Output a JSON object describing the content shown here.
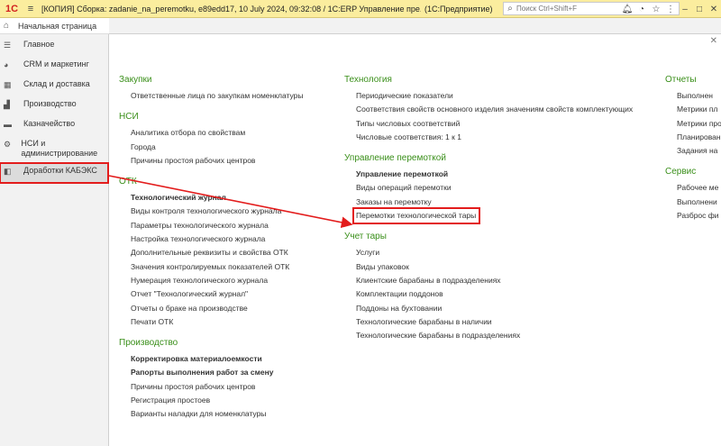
{
  "titlebar": {
    "logo": "1С",
    "title": "[КОПИЯ] Сборка: zadanie_na_peremotku, e89edd17, 10 July 2024, 09:32:08 / 1С:ERP Управление пре...",
    "mode": "(1С:Предприятие)",
    "search_placeholder": "Поиск Ctrl+Shift+F"
  },
  "home_tab": {
    "label": "Начальная страница"
  },
  "sidebar": {
    "items": [
      {
        "label": "Главное",
        "icon": "menu-icon"
      },
      {
        "label": "CRM и маркетинг",
        "icon": "pie-chart-icon"
      },
      {
        "label": "Склад и доставка",
        "icon": "warehouse-icon"
      },
      {
        "label": "Производство",
        "icon": "factory-icon"
      },
      {
        "label": "Казначейство",
        "icon": "money-icon"
      },
      {
        "label": "НСИ и администрирование",
        "icon": "gear-icon"
      },
      {
        "label": "Доработки КАБЭКС",
        "icon": "module-icon"
      }
    ]
  },
  "columns": {
    "left": [
      {
        "title": "Закупки",
        "items": [
          {
            "label": "Ответственные лица по закупкам номенклатуры",
            "bold": false
          }
        ]
      },
      {
        "title": "НСИ",
        "items": [
          {
            "label": "Аналитика отбора по свойствам",
            "bold": false
          },
          {
            "label": "Города",
            "bold": false
          },
          {
            "label": "Причины простоя рабочих центров",
            "bold": false
          }
        ]
      },
      {
        "title": "ОТК",
        "items": [
          {
            "label": "Технологический журнал",
            "bold": true
          },
          {
            "label": "Виды контроля технологического журнала",
            "bold": false
          },
          {
            "label": "Параметры технологического журнала",
            "bold": false
          },
          {
            "label": "Настройка технологического журнала",
            "bold": false
          },
          {
            "label": "Дополнительные реквизиты и свойства ОТК",
            "bold": false
          },
          {
            "label": "Значения контролируемых показателей ОТК",
            "bold": false
          },
          {
            "label": "Нумерация технологического журнала",
            "bold": false
          },
          {
            "label": "Отчет \"Технологический журнал\"",
            "bold": false
          },
          {
            "label": "Отчеты о браке на производстве",
            "bold": false
          },
          {
            "label": "Печати ОТК",
            "bold": false
          }
        ]
      },
      {
        "title": "Производство",
        "items": [
          {
            "label": "Корректировка материалоемкости",
            "bold": true
          },
          {
            "label": "Рапорты выполнения работ за смену",
            "bold": true
          },
          {
            "label": "Причины простоя рабочих центров",
            "bold": false
          },
          {
            "label": "Регистрация простоев",
            "bold": false
          },
          {
            "label": "Варианты наладки для номенклатуры",
            "bold": false
          }
        ]
      }
    ],
    "middle": [
      {
        "title": "Технология",
        "items": [
          {
            "label": "Периодические показатели",
            "bold": false
          },
          {
            "label": "Соответствия свойств основного изделия значениям свойств комплектующих",
            "bold": false
          },
          {
            "label": "Типы числовых соответствий",
            "bold": false
          },
          {
            "label": "Числовые соответствия: 1 к 1",
            "bold": false
          }
        ]
      },
      {
        "title": "Управление перемоткой",
        "items": [
          {
            "label": "Управление перемоткой",
            "bold": true
          },
          {
            "label": "Виды операций перемотки",
            "bold": false
          },
          {
            "label": "Заказы на перемотку",
            "bold": false
          },
          {
            "label": "Перемотки технологической тары",
            "bold": false,
            "highlight": true
          }
        ]
      },
      {
        "title": "Учет тары",
        "items": [
          {
            "label": "Услуги",
            "bold": false
          },
          {
            "label": "Виды упаковок",
            "bold": false
          },
          {
            "label": "Клиентские барабаны в подразделениях",
            "bold": false
          },
          {
            "label": "Комплектации поддонов",
            "bold": false
          },
          {
            "label": "Поддоны на бухтовании",
            "bold": false
          },
          {
            "label": "Технологические барабаны в наличии",
            "bold": false
          },
          {
            "label": "Технологические барабаны в подразделениях",
            "bold": false
          }
        ]
      }
    ],
    "right": [
      {
        "title": "Отчеты",
        "items": [
          {
            "label": "Выполнен",
            "bold": false
          },
          {
            "label": "Метрики пл",
            "bold": false
          },
          {
            "label": "Метрики про",
            "bold": false
          },
          {
            "label": "Планирован",
            "bold": false
          },
          {
            "label": "Задания на",
            "bold": false
          }
        ]
      },
      {
        "title": "Сервис",
        "items": [
          {
            "label": "Рабочее ме",
            "bold": false
          },
          {
            "label": "Выполнени",
            "bold": false
          },
          {
            "label": "Разброс фи",
            "bold": false
          }
        ]
      }
    ]
  },
  "colors": {
    "accent_green": "#3a8f1a",
    "highlight_red": "#e31c1c",
    "titlebar_bg": "#fbed9e"
  }
}
